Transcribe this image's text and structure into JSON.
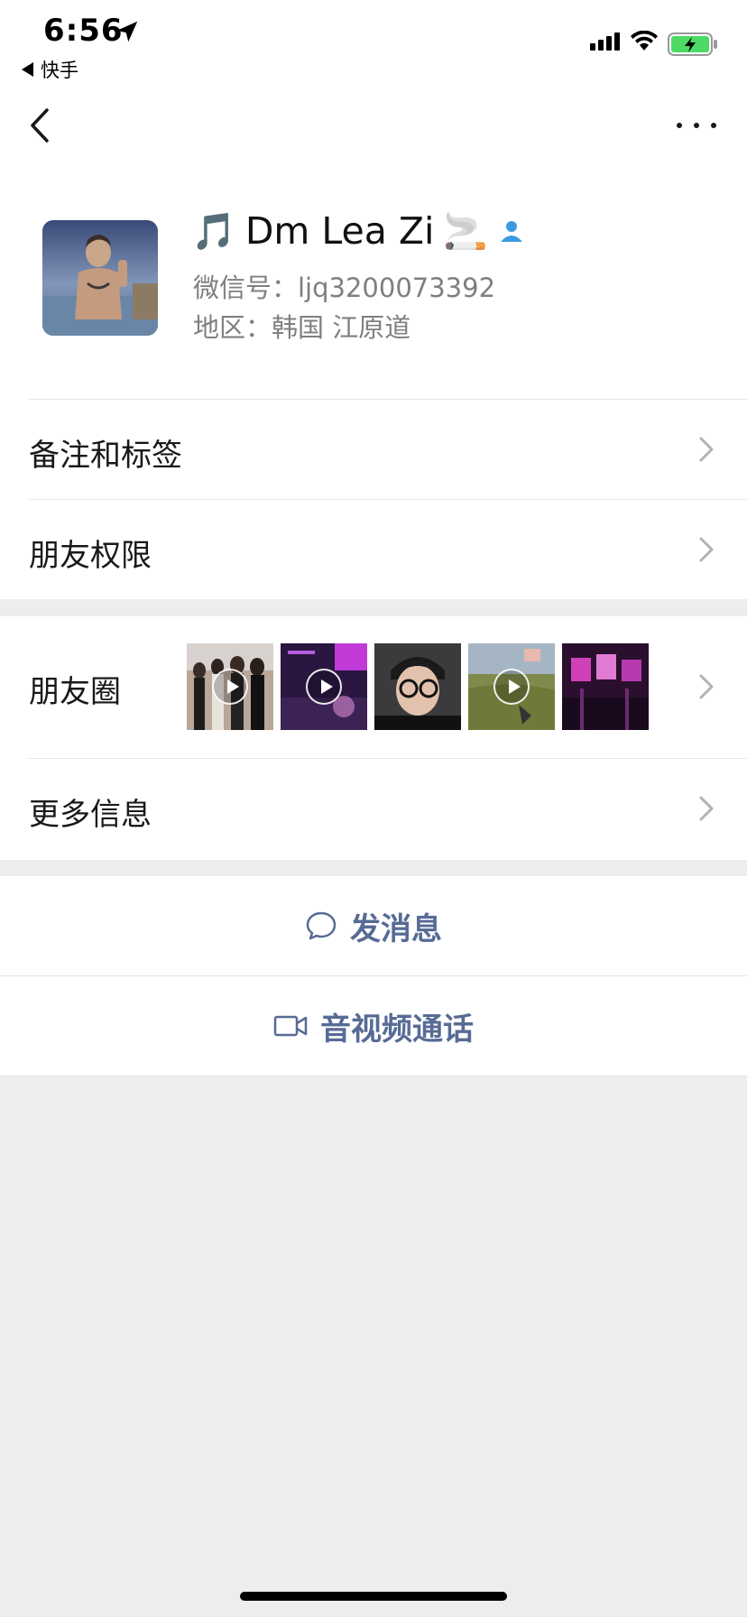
{
  "status_bar": {
    "time": "6:56",
    "back_app": "快手"
  },
  "profile": {
    "name": "Dm Lea Zi",
    "name_prefix_emoji": "🎵",
    "name_suffix_emoji": "🚬",
    "wechat_id": "微信号：ljq3200073392",
    "region": "地区：韩国 江原道"
  },
  "menu": {
    "remarks_tags": "备注和标签",
    "friend_permissions": "朋友权限",
    "moments": "朋友圈",
    "more_info": "更多信息"
  },
  "moments_thumbs": [
    {
      "video": true
    },
    {
      "video": true
    },
    {
      "video": false
    },
    {
      "video": true
    },
    {
      "video": false
    }
  ],
  "actions": {
    "send_message": "发消息",
    "av_call": "音视频通话"
  },
  "colors": {
    "link": "#576b95",
    "background": "#ededed",
    "contact_icon": "#3b9ae1"
  }
}
